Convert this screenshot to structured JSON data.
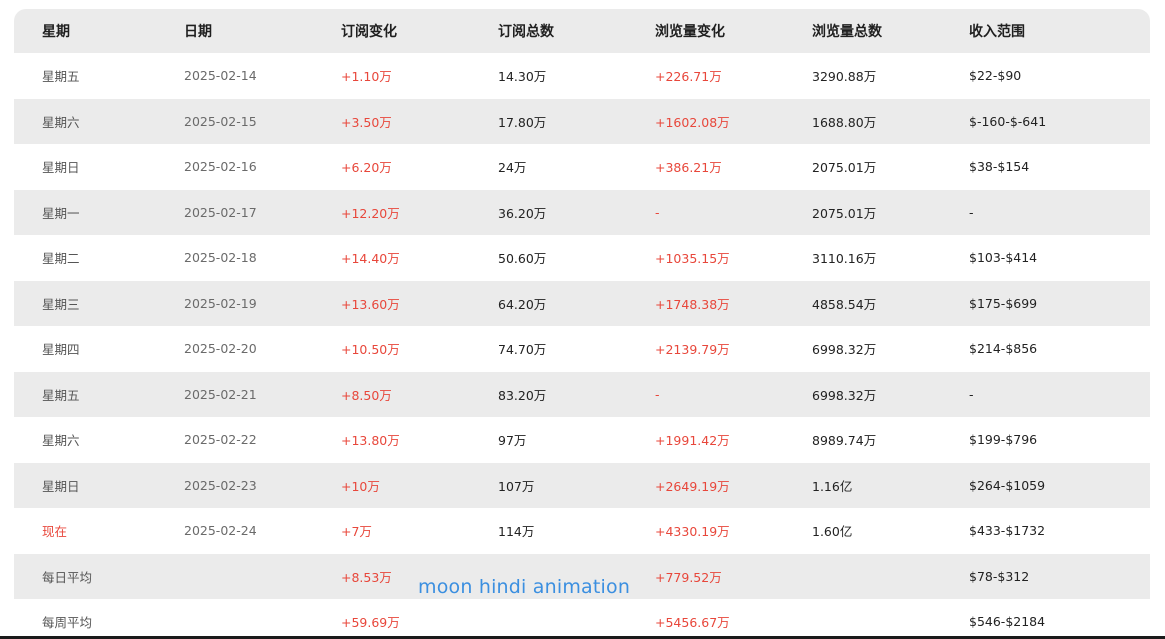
{
  "table": {
    "headers": [
      "星期",
      "日期",
      "订阅变化",
      "订阅总数",
      "浏览量变化",
      "浏览量总数",
      "收入范围"
    ],
    "rows": [
      {
        "day": "星期五",
        "date": "2025-02-14",
        "sub_change": "+1.10万",
        "sub_total": "14.30万",
        "view_change": "+226.71万",
        "view_total": "3290.88万",
        "income": "$22-$90"
      },
      {
        "day": "星期六",
        "date": "2025-02-15",
        "sub_change": "+3.50万",
        "sub_total": "17.80万",
        "view_change": "+1602.08万",
        "view_total": "1688.80万",
        "income": "$-160-$-641"
      },
      {
        "day": "星期日",
        "date": "2025-02-16",
        "sub_change": "+6.20万",
        "sub_total": "24万",
        "view_change": "+386.21万",
        "view_total": "2075.01万",
        "income": "$38-$154"
      },
      {
        "day": "星期一",
        "date": "2025-02-17",
        "sub_change": "+12.20万",
        "sub_total": "36.20万",
        "view_change": "-",
        "view_total": "2075.01万",
        "income": "-"
      },
      {
        "day": "星期二",
        "date": "2025-02-18",
        "sub_change": "+14.40万",
        "sub_total": "50.60万",
        "view_change": "+1035.15万",
        "view_total": "3110.16万",
        "income": "$103-$414"
      },
      {
        "day": "星期三",
        "date": "2025-02-19",
        "sub_change": "+13.60万",
        "sub_total": "64.20万",
        "view_change": "+1748.38万",
        "view_total": "4858.54万",
        "income": "$175-$699"
      },
      {
        "day": "星期四",
        "date": "2025-02-20",
        "sub_change": "+10.50万",
        "sub_total": "74.70万",
        "view_change": "+2139.79万",
        "view_total": "6998.32万",
        "income": "$214-$856"
      },
      {
        "day": "星期五",
        "date": "2025-02-21",
        "sub_change": "+8.50万",
        "sub_total": "83.20万",
        "view_change": "-",
        "view_total": "6998.32万",
        "income": "-"
      },
      {
        "day": "星期六",
        "date": "2025-02-22",
        "sub_change": "+13.80万",
        "sub_total": "97万",
        "view_change": "+1991.42万",
        "view_total": "8989.74万",
        "income": "$199-$796"
      },
      {
        "day": "星期日",
        "date": "2025-02-23",
        "sub_change": "+10万",
        "sub_total": "107万",
        "view_change": "+2649.19万",
        "view_total": "1.16亿",
        "income": "$264-$1059"
      },
      {
        "day": "现在",
        "date": "2025-02-24",
        "sub_change": "+7万",
        "sub_total": "114万",
        "view_change": "+4330.19万",
        "view_total": "1.60亿",
        "income": "$433-$1732"
      },
      {
        "day": "每日平均",
        "date": "",
        "sub_change": "+8.53万",
        "sub_total": "",
        "view_change": "+779.52万",
        "view_total": "",
        "income": "$78-$312"
      },
      {
        "day": "每周平均",
        "date": "",
        "sub_change": "+59.69万",
        "sub_total": "",
        "view_change": "+5456.67万",
        "view_total": "",
        "income": "$546-$2184"
      }
    ]
  },
  "watermark": "moon hindi animation",
  "colors": {
    "accent_red": "#e8473b",
    "row_alt": "#ebebeb",
    "watermark_blue": "#3b8fe0"
  }
}
